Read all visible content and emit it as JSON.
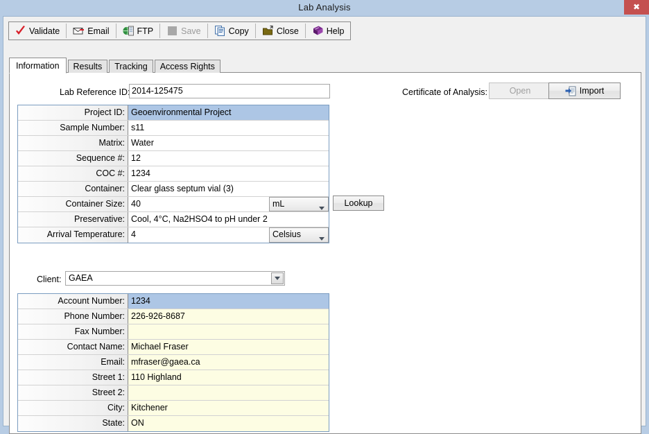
{
  "window": {
    "title": "Lab Analysis",
    "close_glyph": "✖",
    "close_color": "#c4504f",
    "titlebar_color": "#b7cce4"
  },
  "toolbar": {
    "items": [
      {
        "label": "Validate",
        "icon": "checkmark-icon",
        "enabled": true
      },
      {
        "label": "Email",
        "icon": "envelope-icon",
        "enabled": true
      },
      {
        "label": "FTP",
        "icon": "ftp-server-icon",
        "enabled": true
      },
      {
        "label": "Save",
        "icon": "save-disk-icon",
        "enabled": false
      },
      {
        "label": "Copy",
        "icon": "copy-pages-icon",
        "enabled": true
      },
      {
        "label": "Close",
        "icon": "folder-out-icon",
        "enabled": true
      },
      {
        "label": "Help",
        "icon": "help-book-icon",
        "enabled": true
      }
    ]
  },
  "tabs": [
    {
      "label": "Information",
      "active": true
    },
    {
      "label": "Results",
      "active": false
    },
    {
      "label": "Tracking",
      "active": false
    },
    {
      "label": "Access Rights",
      "active": false
    }
  ],
  "information": {
    "lab_reference": {
      "label": "Lab Reference ID:",
      "value": "2014-125475"
    },
    "certificate": {
      "label": "Certificate of Analysis:",
      "open_button": "Open",
      "open_enabled": false,
      "import_button": "Import",
      "import_icon": "import-document-icon"
    },
    "sample_grid": {
      "selected_row": 0,
      "rows": [
        {
          "name": "Project ID:",
          "value": "Geoenvironmental Project"
        },
        {
          "name": "Sample Number:",
          "value": "s11"
        },
        {
          "name": "Matrix:",
          "value": "Water"
        },
        {
          "name": "Sequence #:",
          "value": "12"
        },
        {
          "name": "COC #:",
          "value": "1234"
        },
        {
          "name": "Container:",
          "value": "Clear glass septum vial (3)"
        },
        {
          "name": "Container Size:",
          "value": "40",
          "combo": "mL"
        },
        {
          "name": "Preservative:",
          "value": "Cool, 4°C, Na2HSO4 to pH under 2"
        },
        {
          "name": "Arrival Temperature:",
          "value": "4",
          "combo": "Celsius"
        }
      ]
    },
    "lookup_button": "Lookup",
    "client": {
      "label": "Client:",
      "value": "GAEA"
    },
    "client_grid": {
      "selected_row": 0,
      "rows": [
        {
          "name": "Account Number:",
          "value": "1234"
        },
        {
          "name": "Phone Number:",
          "value": "226-926-8687"
        },
        {
          "name": "Fax Number:",
          "value": ""
        },
        {
          "name": "Contact Name:",
          "value": "Michael Fraser"
        },
        {
          "name": "Email:",
          "value": "mfraser@gaea.ca"
        },
        {
          "name": "Street 1:",
          "value": "110 Highland"
        },
        {
          "name": "Street 2:",
          "value": ""
        },
        {
          "name": "City:",
          "value": "Kitchener"
        },
        {
          "name": "State:",
          "value": "ON"
        }
      ]
    }
  }
}
